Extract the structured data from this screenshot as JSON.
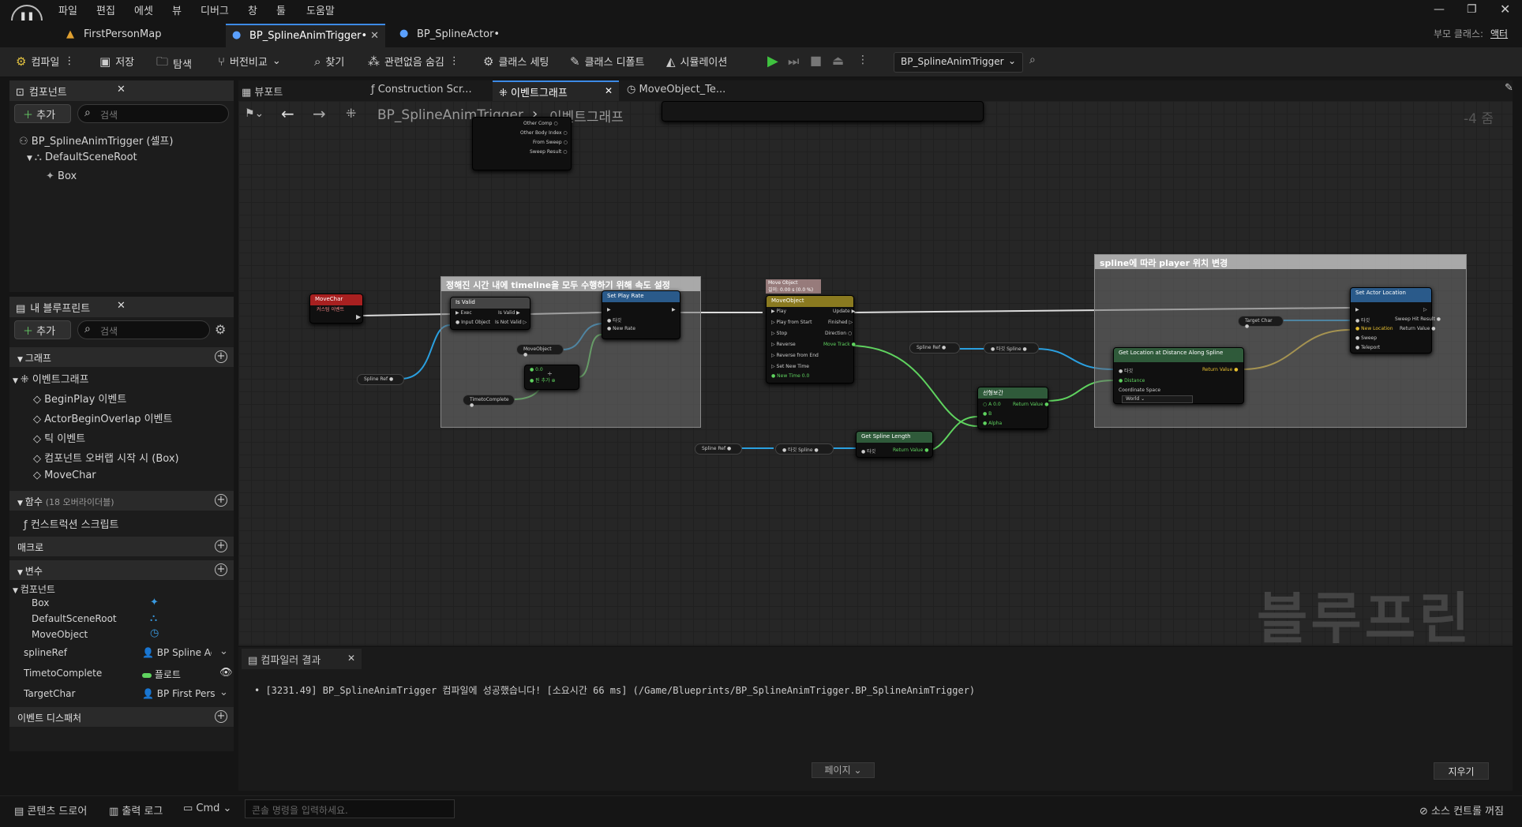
{
  "menu": [
    "파일",
    "편집",
    "에셋",
    "뷰",
    "디버그",
    "창",
    "툴",
    "도움말"
  ],
  "tabs": [
    {
      "label": "FirstPersonMap"
    },
    {
      "label": "BP_SplineAnimTrigger•"
    },
    {
      "label": "BP_SplineActor•"
    }
  ],
  "parent_class": {
    "label": "부모 클래스:",
    "value": "액터"
  },
  "toolbar": {
    "compile": "컴파일",
    "save": "저장",
    "browse": "탐색",
    "diff": "버전비교",
    "find": "찾기",
    "hide_unrelated": "관련없음 숨김",
    "class_settings": "클래스 세팅",
    "class_defaults": "클래스 디폴트",
    "simulation": "시뮬레이션",
    "debug_target": "BP_SplineAnimTrigger"
  },
  "components": {
    "title": "컴포넌트",
    "add": "추가",
    "search": "검색",
    "items": [
      "BP_SplineAnimTrigger (셀프)",
      "DefaultSceneRoot",
      "Box"
    ]
  },
  "my_blueprint": {
    "title": "내 블루프린트",
    "add": "추가",
    "search": "검색",
    "graph_section": "그래프",
    "event_graph": "이벤트그래프",
    "events": [
      "BeginPlay 이벤트",
      "ActorBeginOverlap 이벤트",
      "틱 이벤트",
      "컴포넌트 오버랩 시작 시 (Box)",
      "MoveChar"
    ],
    "functions": "함수",
    "functions_count": "(18 오버라이더블)",
    "construction": "컨스트럭션 스크립트",
    "macros": "매크로",
    "variables": "변수",
    "components_cat": "컴포넌트",
    "comp_vars": [
      "Box",
      "DefaultSceneRoot",
      "MoveObject"
    ],
    "vars": [
      {
        "name": "splineRef",
        "type": "BP Spline Ac"
      },
      {
        "name": "TimetoComplete",
        "type": "플로트"
      },
      {
        "name": "TargetChar",
        "type": "BP First Pers"
      }
    ],
    "dispatchers": "이벤트 디스패처"
  },
  "graph_tabs": [
    "뷰포트",
    "Construction Scr...",
    "이벤트그래프",
    "MoveObject_Te..."
  ],
  "breadcrumb": {
    "root": "BP_SplineAnimTrigger",
    "current": "이벤트그래프",
    "zoom": "-4 줌"
  },
  "watermark": "블루프린트",
  "comments": [
    "정해진 시간 내에 timeline을 모두 수행하기 위해 속도 설정",
    "spline에 따라 player 위치 변경"
  ],
  "nodes": {
    "movechar": "MoveChar",
    "movechar_sub": "커스텀 이벤트",
    "isvalid": "Is Valid",
    "set_play_rate": "Set Play Rate",
    "move_object": "MoveObject",
    "set_actor_location": "Set Actor Location",
    "get_location": "Get Location at Distance Along Spline",
    "lerp": "선형보간",
    "get_spline_length": "Get Spline Length",
    "timeline_label": "Move Object",
    "timeline_sub": "길이: 0.00 s (0.0 %)"
  },
  "compiler": {
    "title": "컴파일러 결과",
    "message": "[3231.49] BP_SplineAnimTrigger 컴파일에 성공했습니다! [소요시간 66 ms] (/Game/Blueprints/BP_SplineAnimTrigger.BP_SplineAnimTrigger)",
    "page": "페이지",
    "clear": "지우기"
  },
  "statusbar": {
    "content_drawer": "콘텐츠 드로어",
    "output_log": "출력 로그",
    "cmd": "Cmd",
    "console_placeholder": "콘솔 명령을 입력하세요.",
    "source_control": "소스 컨트롤 꺼짐"
  }
}
